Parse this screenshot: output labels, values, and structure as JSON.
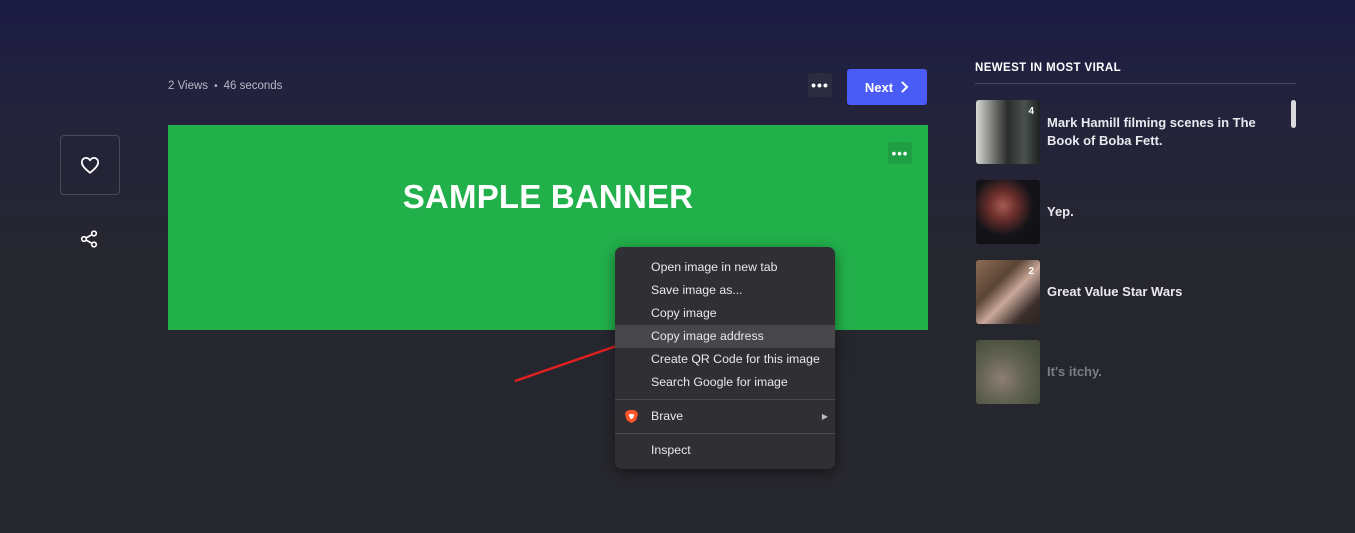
{
  "post": {
    "views": "2 Views",
    "separator": "•",
    "age": "46 seconds",
    "next_label": "Next",
    "more_label": "•••",
    "banner_text": "SAMPLE BANNER",
    "banner_color": "#22b04b"
  },
  "context_menu": {
    "items": [
      "Open image in new tab",
      "Save image as...",
      "Copy image",
      "Copy image address",
      "Create QR Code for this image",
      "Search Google for image"
    ],
    "highlighted": "Copy image address",
    "extension": "Brave",
    "inspect": "Inspect"
  },
  "sidebar": {
    "title": "NEWEST IN MOST VIRAL",
    "items": [
      {
        "title": "Mark Hamill filming scenes in The Book of Boba Fett.",
        "count": "4"
      },
      {
        "title": "Yep.",
        "count": ""
      },
      {
        "title": "Great Value Star Wars",
        "count": "2"
      },
      {
        "title": "It's itchy.",
        "count": ""
      }
    ]
  },
  "colors": {
    "accent": "#4b5cf6",
    "annotation_arrow": "#e02020"
  }
}
